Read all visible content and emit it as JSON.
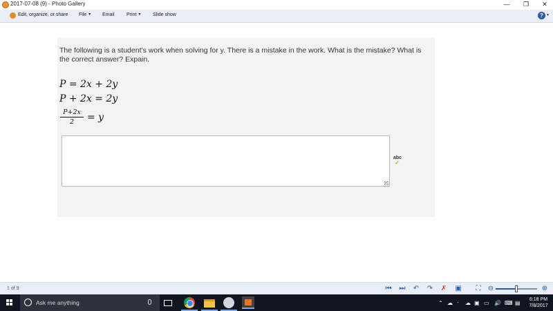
{
  "window": {
    "title": "2017-07-08 (9) - Photo Gallery"
  },
  "commandbar": {
    "edit_label": "Edit, organize, or share",
    "file_label": "File",
    "email_label": "Email",
    "print_label": "Print",
    "slideshow_label": "Slide show",
    "help_label": "?"
  },
  "photo": {
    "question": "The following is a student’s work when solving for y.  There is a mistake in the work.  What is the mistake? What is the correct answer? Expain.",
    "equation_1": "P = 2x + 2y",
    "equation_2": "P + 2x = 2y",
    "fraction_numerator": "P+2x",
    "fraction_denominator": "2",
    "fraction_rhs": "= y",
    "spellcheck_label": "abc",
    "answer_text": ""
  },
  "status": {
    "page_count": "1 of 9",
    "zoom_level_fraction": 0.5
  },
  "taskbar": {
    "search_placeholder": "Ask me anything",
    "time": "6:18 PM",
    "date": "7/8/2017"
  },
  "colors": {
    "accent": "#1f5fb6",
    "commandbar_bg": "#e9eef6",
    "taskbar_bg": "#101520",
    "photo_bg": "#f3f3f3"
  }
}
